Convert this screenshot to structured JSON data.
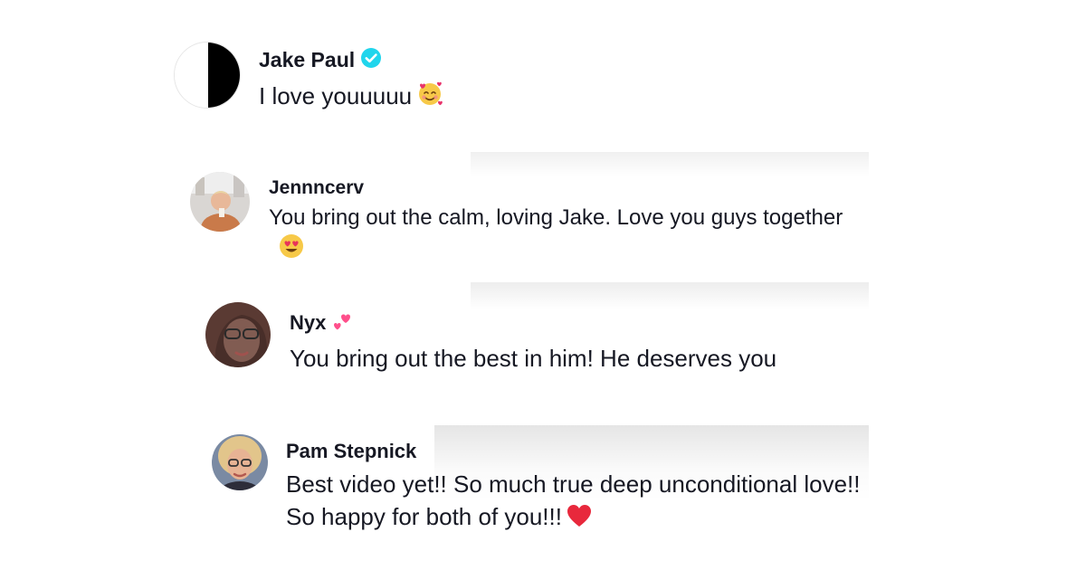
{
  "comments": [
    {
      "username": "Jake Paul",
      "verified": true,
      "text": "I love youuuuu",
      "emoji": "smiling-face-with-hearts-icon",
      "avatar": "half-black-half-white-avatar"
    },
    {
      "username": "Jennncerv",
      "verified": false,
      "text": "You bring out the calm, loving Jake. Love you guys together",
      "emoji": "heart-eyes-icon",
      "avatar": "photo-avatar"
    },
    {
      "username": "Nyx",
      "username_emoji": "two-hearts-icon",
      "verified": false,
      "text": "You bring out the best in him! He deserves you",
      "avatar": "photo-avatar"
    },
    {
      "username": "Pam Stepnick",
      "verified": false,
      "text": "Best video yet!! So much true deep unconditional love!! So happy for both of you!!!",
      "emoji": "red-heart-icon",
      "avatar": "photo-avatar"
    }
  ],
  "colors": {
    "text": "#161823",
    "verified_badge": "#20d5ec",
    "meta_text": "#8a8b91"
  }
}
